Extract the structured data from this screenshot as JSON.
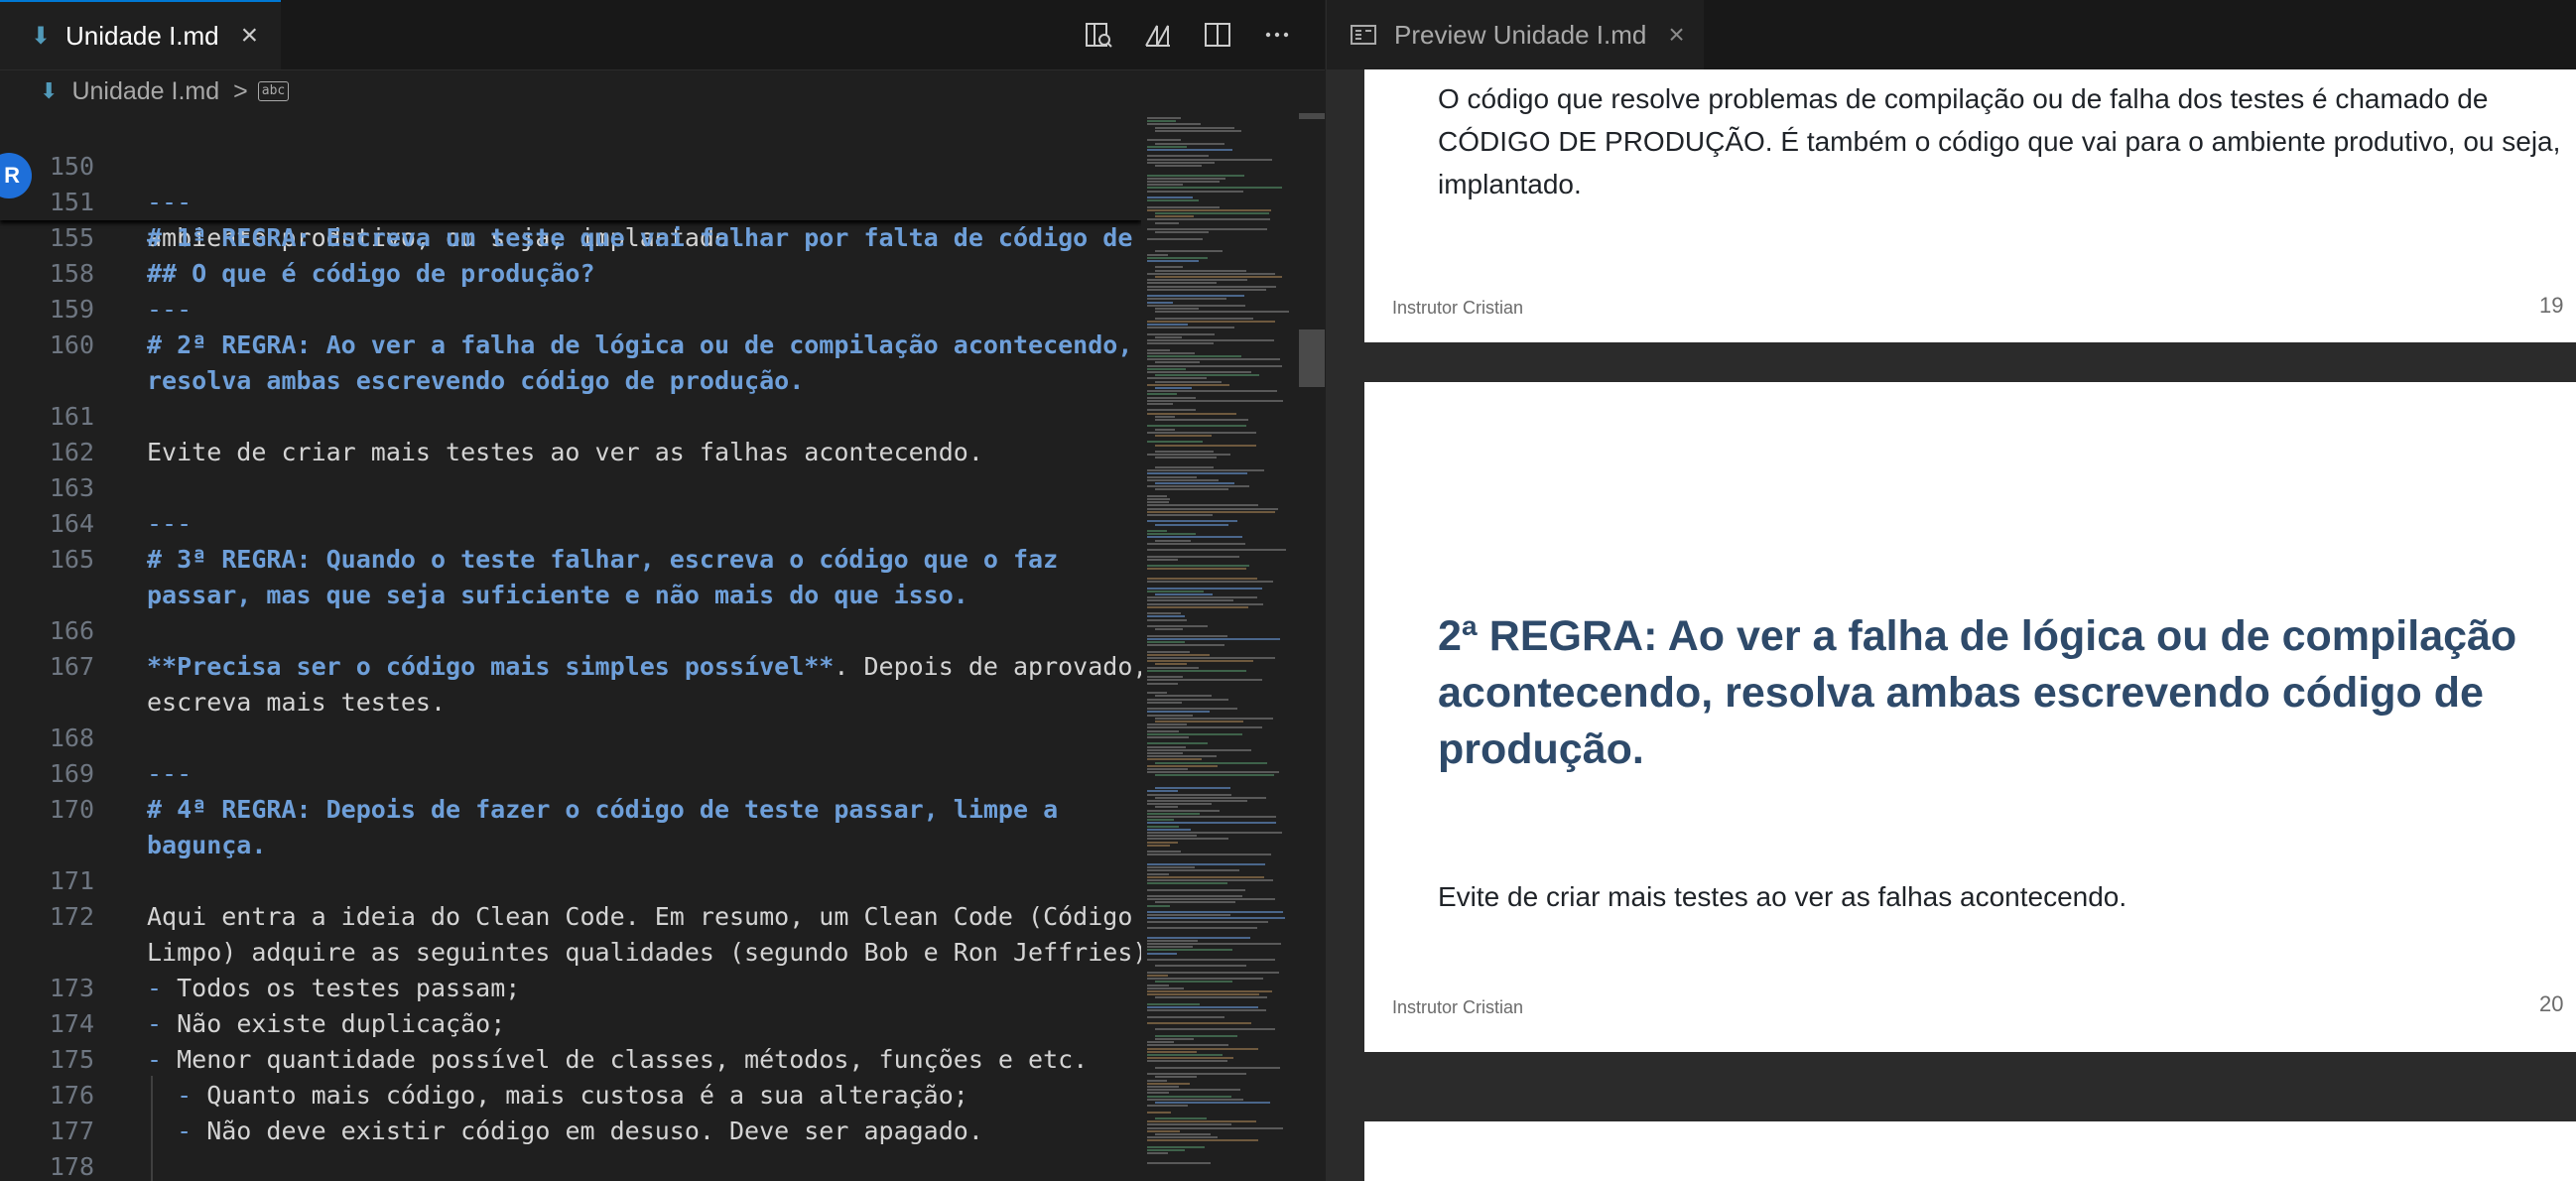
{
  "editor": {
    "tab_title": "Unidade I.md",
    "breadcrumb_file": "Unidade I.md",
    "breadcrumb_sep": ">",
    "breadcrumb_symbol": "abc",
    "avatar_initial": "R",
    "sticky": [
      {
        "num": "150",
        "text": "---"
      },
      {
        "num": "151",
        "text": "# 1ª REGRA: Escreva um teste que vai falhar por falta de código de"
      },
      {
        "num": "155",
        "text": "## O que é código de produção?"
      }
    ],
    "lines": [
      {
        "num": "",
        "text": "ambiente produtivo, ou seja, implantado."
      },
      {
        "num": "158",
        "text": ""
      },
      {
        "num": "159",
        "text": "---"
      },
      {
        "num": "160",
        "text": "# 2ª REGRA: Ao ver a falha de lógica ou de compilação acontecendo,"
      },
      {
        "num": "",
        "text": "resolva ambas escrevendo código de produção."
      },
      {
        "num": "161",
        "text": ""
      },
      {
        "num": "162",
        "text": "Evite de criar mais testes ao ver as falhas acontecendo."
      },
      {
        "num": "163",
        "text": ""
      },
      {
        "num": "164",
        "text": "---"
      },
      {
        "num": "165",
        "text": "# 3ª REGRA: Quando o teste falhar, escreva o código que o faz"
      },
      {
        "num": "",
        "text": "passar, mas que seja suficiente e não mais do que isso."
      },
      {
        "num": "166",
        "text": ""
      },
      {
        "num": "167",
        "bold": "**Precisa ser o código mais simples possível**",
        "text": ". Depois de aprovado,"
      },
      {
        "num": "",
        "text": "escreva mais testes."
      },
      {
        "num": "168",
        "text": ""
      },
      {
        "num": "169",
        "text": "---"
      },
      {
        "num": "170",
        "text": "# 4ª REGRA: Depois de fazer o código de teste passar, limpe a"
      },
      {
        "num": "",
        "text": "bagunça."
      },
      {
        "num": "171",
        "text": ""
      },
      {
        "num": "172",
        "text": "Aqui entra a ideia do Clean Code. Em resumo, um Clean Code (Código"
      },
      {
        "num": "",
        "text": "Limpo) adquire as seguintes qualidades (segundo Bob e Ron Jeffries):"
      },
      {
        "num": "173",
        "dash": "-",
        "text": " Todos os testes passam;"
      },
      {
        "num": "174",
        "dash": "-",
        "text": " Não existe duplicação;"
      },
      {
        "num": "175",
        "dash": "-",
        "text": " Menor quantidade possível de classes, métodos, funções e etc."
      },
      {
        "num": "176",
        "dash": "  -",
        "text": " Quanto mais código, mais custosa é a sua alteração;"
      },
      {
        "num": "177",
        "dash": "  -",
        "text": " Não deve existir código em desuso. Deve ser apagado."
      },
      {
        "num": "178",
        "text": ""
      }
    ]
  },
  "preview": {
    "tab_title": "Preview Unidade I.md",
    "slide19": {
      "lines": [
        "O código que resolve problemas de compilação ou de falha dos testes é chamado de",
        "CÓDIGO DE PRODUÇÃO. É também o código que vai para o ambiente produtivo, ou seja,",
        "implantado."
      ],
      "footer": "Instrutor Cristian",
      "page": "19"
    },
    "slide20": {
      "heading": "2ª REGRA: Ao ver a falha de lógica ou de compilação acontecendo, resolva ambas escrevendo código de produção.",
      "body": "Evite de criar mais testes ao ver as falhas acontecendo.",
      "footer": "Instrutor Cristian",
      "page": "20"
    }
  },
  "colors": {
    "accent": "#0078d4",
    "heading_md": "#6e9fd9",
    "slide_heading": "#2e4a6a",
    "editor_bg": "#1f1f1f"
  }
}
